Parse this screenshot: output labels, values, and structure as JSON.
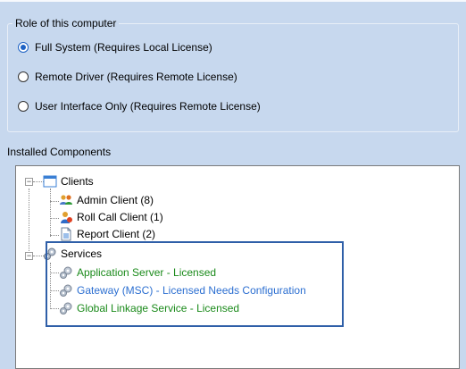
{
  "role_group": {
    "title": "Role of this computer",
    "options": [
      {
        "label": "Full System (Requires Local License)",
        "selected": true
      },
      {
        "label": "Remote Driver (Requires Remote License)",
        "selected": false
      },
      {
        "label": "User Interface Only (Requires Remote License)",
        "selected": false
      }
    ]
  },
  "installed": {
    "label": "Installed Components",
    "tree": {
      "clients": {
        "label": "Clients",
        "expander": "−",
        "icon": "window-icon",
        "children": [
          {
            "label": "Admin Client (8)",
            "icon": "users-icon"
          },
          {
            "label": "Roll Call Client (1)",
            "icon": "user-icon"
          },
          {
            "label": "Report Client (2)",
            "icon": "document-icon"
          }
        ]
      },
      "services": {
        "label": "Services",
        "expander": "−",
        "icon": "gears-icon",
        "children": [
          {
            "label": "Application Server - Licensed",
            "icon": "gear-icon",
            "color": "#1a8a1a"
          },
          {
            "label": "Gateway (MSC) - Licensed Needs Configuration",
            "icon": "gear-icon",
            "color": "#2c6fd1"
          },
          {
            "label": "Global Linkage Service - Licensed",
            "icon": "gear-icon",
            "color": "#1a8a1a"
          }
        ]
      }
    }
  }
}
